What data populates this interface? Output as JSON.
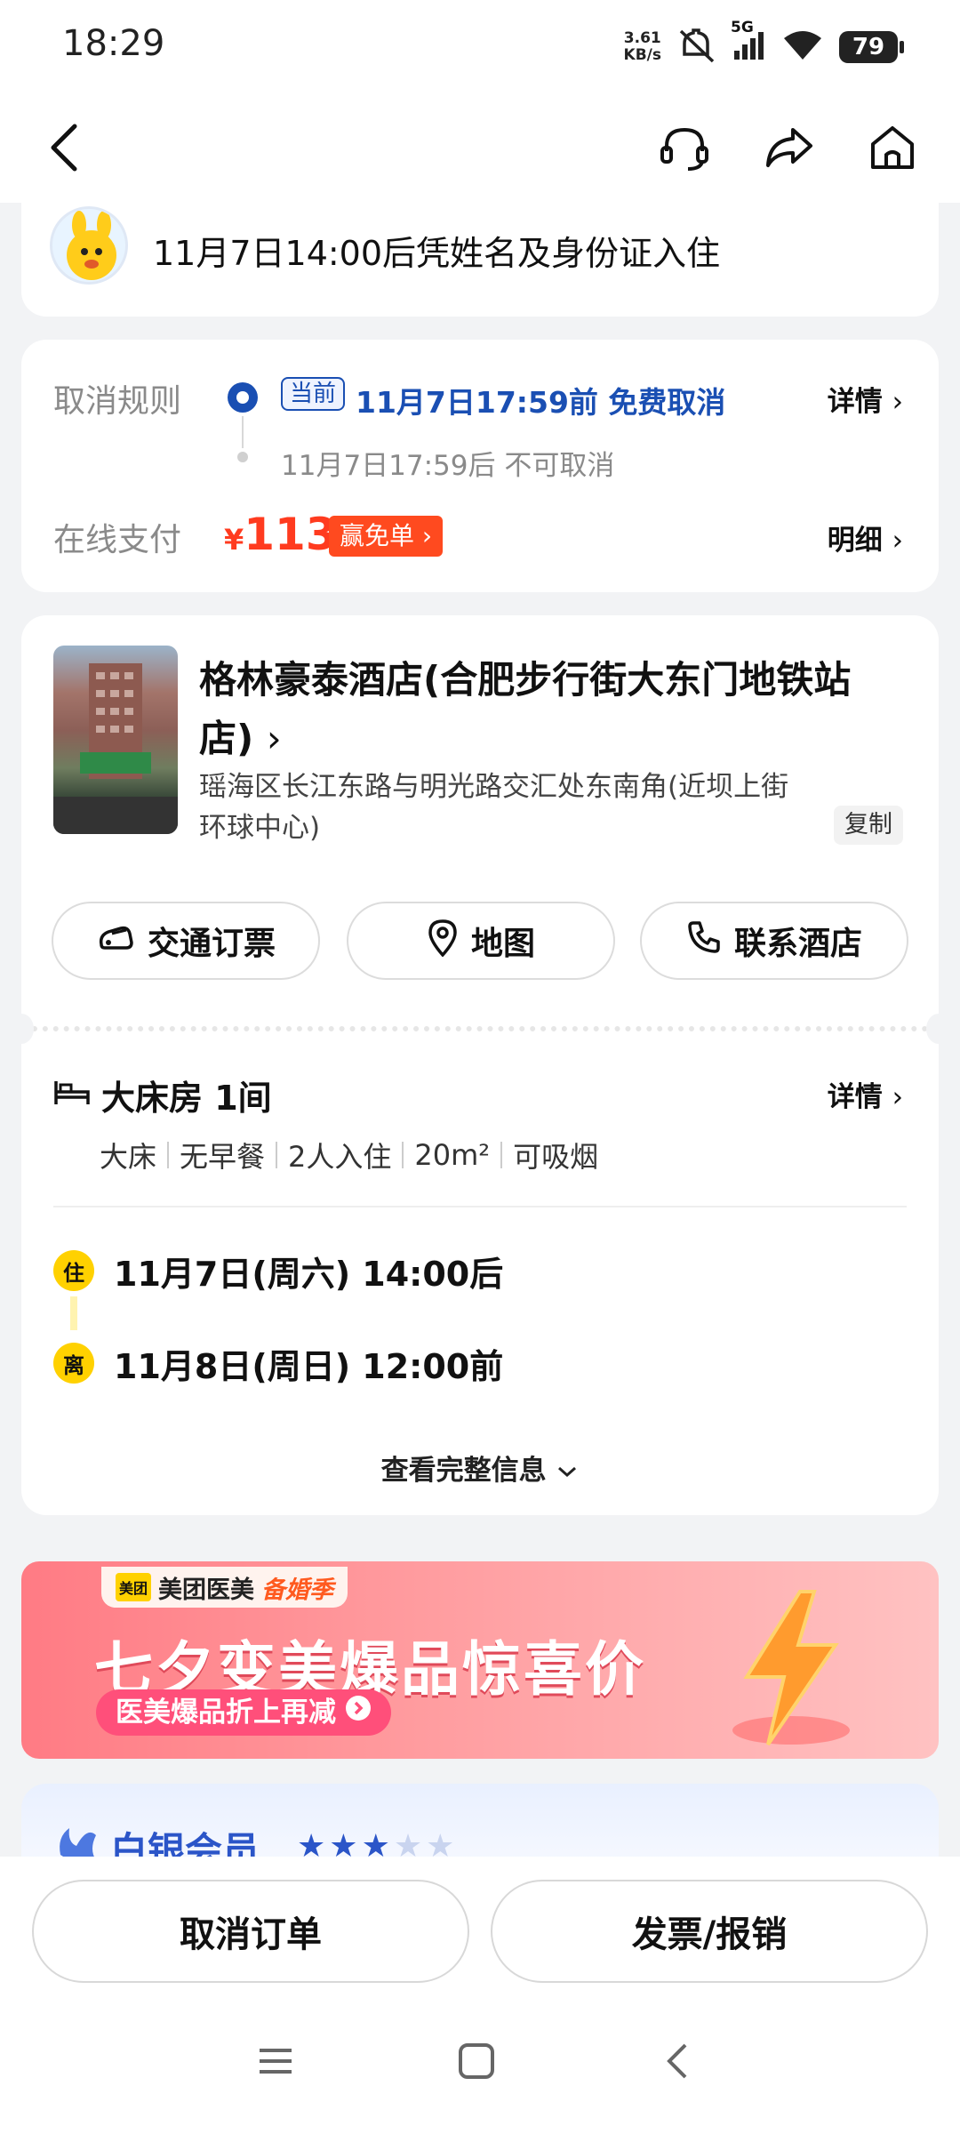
{
  "status_bar": {
    "time": "18:29",
    "net_speed_value": "3.61",
    "net_speed_unit": "KB/s",
    "network": "5G",
    "battery": "79"
  },
  "nav": {
    "icons": [
      "back-icon",
      "headset-icon",
      "share-icon",
      "home-icon"
    ]
  },
  "checkin": {
    "text": "11月7日14:00后凭姓名及身份证入住"
  },
  "cancel_rules": {
    "label": "取消规则",
    "current_tag": "当前",
    "free_cancel": "11月7日17:59前 免费取消",
    "after": "11月7日17:59后 不可取消",
    "detail_link": "详情",
    "payment_label": "在线支付",
    "currency": "¥",
    "amount": "113",
    "free_order_tag": "赢免单",
    "breakdown_link": "明细"
  },
  "hotel": {
    "name": "格林豪泰酒店(合肥步行街大东门地铁站店)",
    "address": "瑶海区长江东路与明光路交汇处东南角(近坝上街环球中心)",
    "copy_label": "复制",
    "actions": [
      {
        "label": "交通订票",
        "icon": "car-icon"
      },
      {
        "label": "地图",
        "icon": "location-pin-icon"
      },
      {
        "label": "联系酒店",
        "icon": "phone-icon"
      }
    ]
  },
  "room": {
    "title": "大床房 1间",
    "detail_link": "详情",
    "features": [
      "大床",
      "无早餐",
      "2人入住",
      "20m²",
      "可吸烟"
    ],
    "checkin_badge": "住",
    "checkin_time": "11月7日(周六) 14:00后",
    "checkout_badge": "离",
    "checkout_time": "11月8日(周日) 12:00前",
    "view_full": "查看完整信息"
  },
  "banner": {
    "brand_logo": "美团",
    "brand": "美团医美",
    "season": "备婚季",
    "title": "七夕变美爆品惊喜价",
    "subtitle": "医美爆品折上再减"
  },
  "member": {
    "title": "白银会员",
    "stars_filled": 3,
    "stars_total": 5
  },
  "bottom_actions": {
    "cancel_order": "取消订单",
    "invoice": "发票/报销"
  },
  "colors": {
    "accent_blue": "#1a4fb3",
    "price_red": "#ff3b1f",
    "badge_yellow": "#ffd100"
  }
}
